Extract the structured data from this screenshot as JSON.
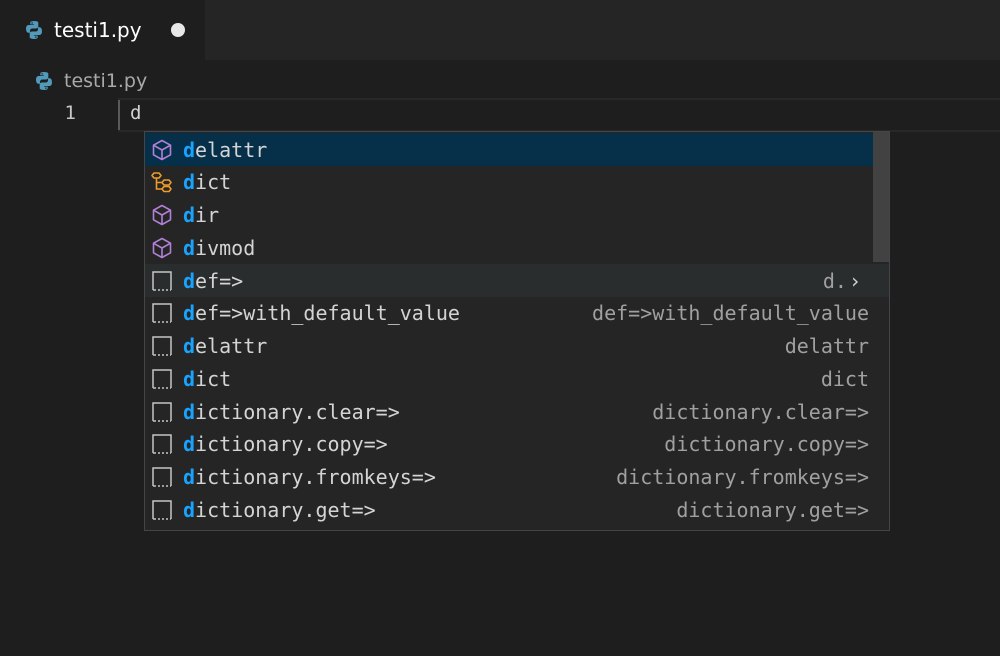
{
  "tab": {
    "filename": "testi1.py"
  },
  "breadcrumb": {
    "filename": "testi1.py"
  },
  "editor": {
    "line_number": "1",
    "line_text": "d"
  },
  "suggestions": [
    {
      "kind": "method",
      "match": "d",
      "rest": "elattr",
      "detail": ""
    },
    {
      "kind": "class",
      "match": "d",
      "rest": "ict",
      "detail": ""
    },
    {
      "kind": "method",
      "match": "d",
      "rest": "ir",
      "detail": ""
    },
    {
      "kind": "method",
      "match": "d",
      "rest": "ivmod",
      "detail": ""
    },
    {
      "kind": "snippet",
      "match": "d",
      "rest": "ef=>",
      "detail": "d.",
      "read_more": "›"
    },
    {
      "kind": "snippet",
      "match": "d",
      "rest": "ef=>with_default_value",
      "detail": "def=>with_default_value"
    },
    {
      "kind": "snippet",
      "match": "d",
      "rest": "elattr",
      "detail": "delattr"
    },
    {
      "kind": "snippet",
      "match": "d",
      "rest": "ict",
      "detail": "dict"
    },
    {
      "kind": "snippet",
      "match": "d",
      "rest": "ictionary.clear=>",
      "detail": "dictionary.clear=>"
    },
    {
      "kind": "snippet",
      "match": "d",
      "rest": "ictionary.copy=>",
      "detail": "dictionary.copy=>"
    },
    {
      "kind": "snippet",
      "match": "d",
      "rest": "ictionary.fromkeys=>",
      "detail": "dictionary.fromkeys=>"
    },
    {
      "kind": "snippet",
      "match": "d",
      "rest": "ictionary.get=>",
      "detail": "dictionary.get=>"
    }
  ],
  "colors": {
    "match": "#18a3ff",
    "method_icon": "#b180d7",
    "class_icon": "#ee9d28",
    "selected_bg": "#062f4a"
  },
  "icons": {
    "method": "cube-icon",
    "class": "class-icon",
    "snippet": "snippet-icon",
    "file": "python-icon"
  }
}
